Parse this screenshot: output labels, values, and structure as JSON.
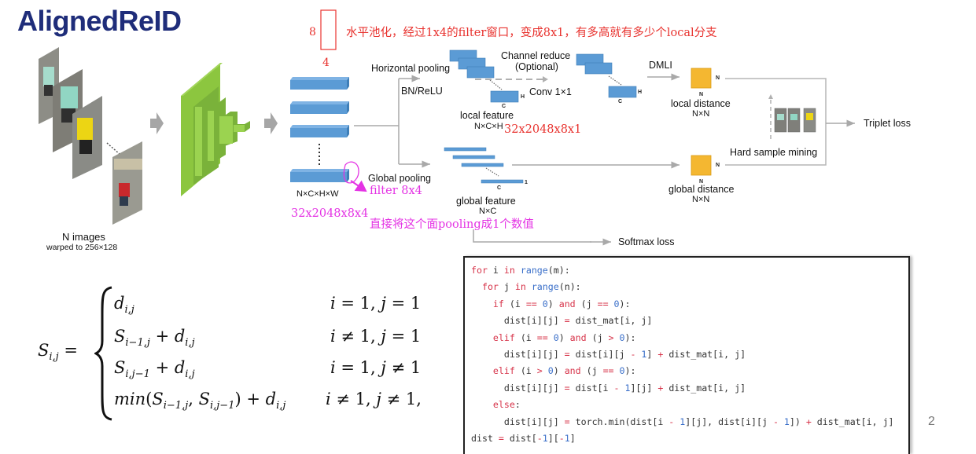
{
  "slide": {
    "title": "AlignedReID",
    "page_number": "2"
  },
  "diagram": {
    "input": {
      "label": "N images",
      "sublabel": "warped to 256×128"
    },
    "feature_map": {
      "shape_label": "N×C×H×W",
      "annotation_size": "32x2048x8x4"
    },
    "pool_box": {
      "height_label": "8",
      "width_label": "4"
    },
    "annotations": {
      "horizontal_pool_note": "水平池化，经过1x4的filter窗口，变成8x1，有多高就有多少个local分支",
      "global_pool_filter": "filter 8x4",
      "global_pool_note": "直接将这个面pooling成1个数值",
      "local_feature_size": "32x2048x8x1"
    },
    "local_branch": {
      "op1": "Horizontal pooling",
      "op2": "BN/ReLU",
      "feature_label": "local feature",
      "feature_shape": "N×C×H",
      "axis_c": "C",
      "axis_h": "H",
      "reduce_label": "Channel reduce",
      "reduce_optional": "(Optional)",
      "conv_label": "Conv 1×1",
      "dmli_label": "DMLI",
      "distance_label": "local distance",
      "distance_shape": "N×N",
      "n_label": "N"
    },
    "global_branch": {
      "op": "Global pooling",
      "feature_label": "global feature",
      "feature_shape": "N×C",
      "axis_c": "C",
      "axis_1": "1",
      "distance_label": "global distance",
      "distance_shape": "N×N",
      "n_label": "N",
      "softmax_label": "Softmax loss"
    },
    "mining_label": "Hard sample mining",
    "triplet_label": "Triplet loss",
    "colors": {
      "feature_blue": "#5b9bd5",
      "cnn_green": "#8cc63f",
      "distance_yellow": "#f4b731",
      "annotation_red": "#e8322e",
      "annotation_magenta": "#e433e4",
      "title_navy": "#1f2d7a"
    }
  },
  "formula": {
    "lhs": "S_{i,j} =",
    "cases": [
      {
        "expr": "d_{i,j}",
        "cond": "i = 1, j = 1"
      },
      {
        "expr": "S_{i-1,j} + d_{i,j}",
        "cond": "i ≠ 1, j = 1"
      },
      {
        "expr": "S_{i,j-1} + d_{i,j}",
        "cond": "i = 1, j ≠ 1"
      },
      {
        "expr": "min(S_{i-1,j}, S_{i,j-1}) + d_{i,j}",
        "cond": "i ≠ 1, j ≠ 1,"
      }
    ]
  },
  "code": {
    "lines": [
      "for i in range(m):",
      "  for j in range(n):",
      "    if (i == 0) and (j == 0):",
      "      dist[i][j] = dist_mat[i, j]",
      "    elif (i == 0) and (j > 0):",
      "      dist[i][j] = dist[i][j - 1] + dist_mat[i, j]",
      "    elif (i > 0) and (j == 0):",
      "      dist[i][j] = dist[i - 1][j] + dist_mat[i, j]",
      "    else:",
      "      dist[i][j] = torch.min(dist[i - 1][j], dist[i][j - 1]) + dist_mat[i, j]",
      "dist = dist[-1][-1]"
    ]
  }
}
